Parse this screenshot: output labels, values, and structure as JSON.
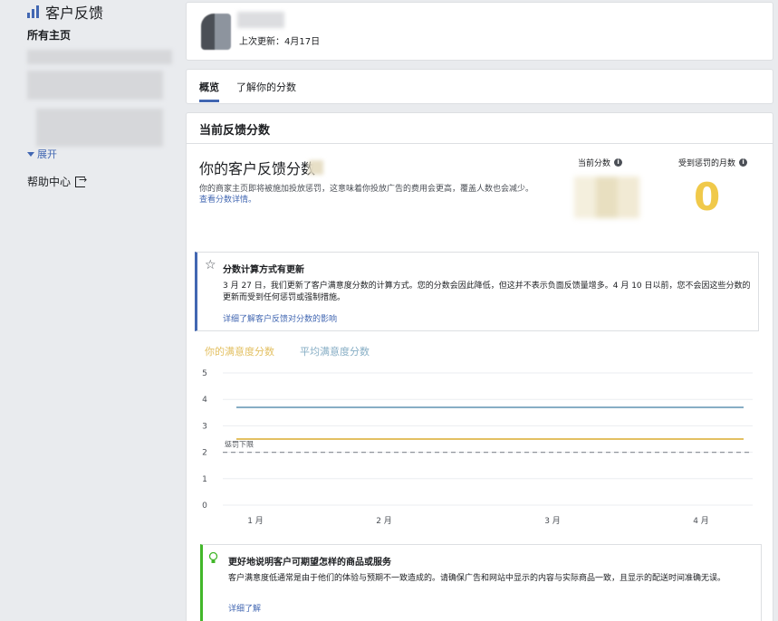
{
  "sidebar": {
    "app_title": "客户反馈",
    "all_pages": "所有主页",
    "expand": "展开",
    "help_center": "帮助中心"
  },
  "header": {
    "last_update": "上次更新：4月17日"
  },
  "tabs": [
    {
      "label": "概览",
      "active": true
    },
    {
      "label": "了解你的分数",
      "active": false
    }
  ],
  "main": {
    "section_title": "当前反馈分数",
    "score_title": "你的客户反馈分数",
    "score_desc": "你的商家主页即将被施加投放惩罚，这意味着你投放广告的费用会更高，覆盖人数也会减少。",
    "score_link": "查看分数详情。",
    "current_score_label": "当前分数",
    "penalty_months_label": "受到惩罚的月数",
    "penalty_months_value": "0"
  },
  "notice": {
    "title": "分数计算方式有更新",
    "body": "3 月 27 日，我们更新了客户满意度分数的计算方式。您的分数会因此降低，但这并不表示负面反馈量增多。4 月 10 日以前，您不会因这些分数的更新而受到任何惩罚或强制措施。",
    "link": "详细了解客户反馈对分数的影响"
  },
  "chart_data": {
    "type": "line",
    "series": [
      {
        "name": "你的满意度分数",
        "color": "#e3c062",
        "x": [
          "1 月",
          "4 月"
        ],
        "values": [
          2.5,
          2.5
        ]
      },
      {
        "name": "平均满意度分数",
        "color": "#87aec5",
        "x": [
          "1 月",
          "4 月"
        ],
        "values": [
          3.7,
          3.7
        ]
      }
    ],
    "threshold": {
      "label": "惩罚下限",
      "value": 2.0
    },
    "xticks": [
      "1 月",
      "2 月",
      "3 月",
      "4 月"
    ],
    "yticks": [
      "0",
      "1",
      "2",
      "3",
      "4",
      "5"
    ],
    "ylim": [
      0,
      5
    ],
    "grid": true,
    "legend": "top-left"
  },
  "tip": {
    "title": "更好地说明客户可期望怎样的商品或服务",
    "body": "客户满意度低通常是由于他们的体验与预期不一致造成的。请确保广告和网站中显示的内容与实际商品一致，且显示的配送时间准确无误。",
    "link": "详细了解"
  },
  "colors": {
    "accent": "#4267b2",
    "score": "#e3c062",
    "average": "#87aec5",
    "penalty": "#f0c94a",
    "tip": "#42b72a"
  }
}
